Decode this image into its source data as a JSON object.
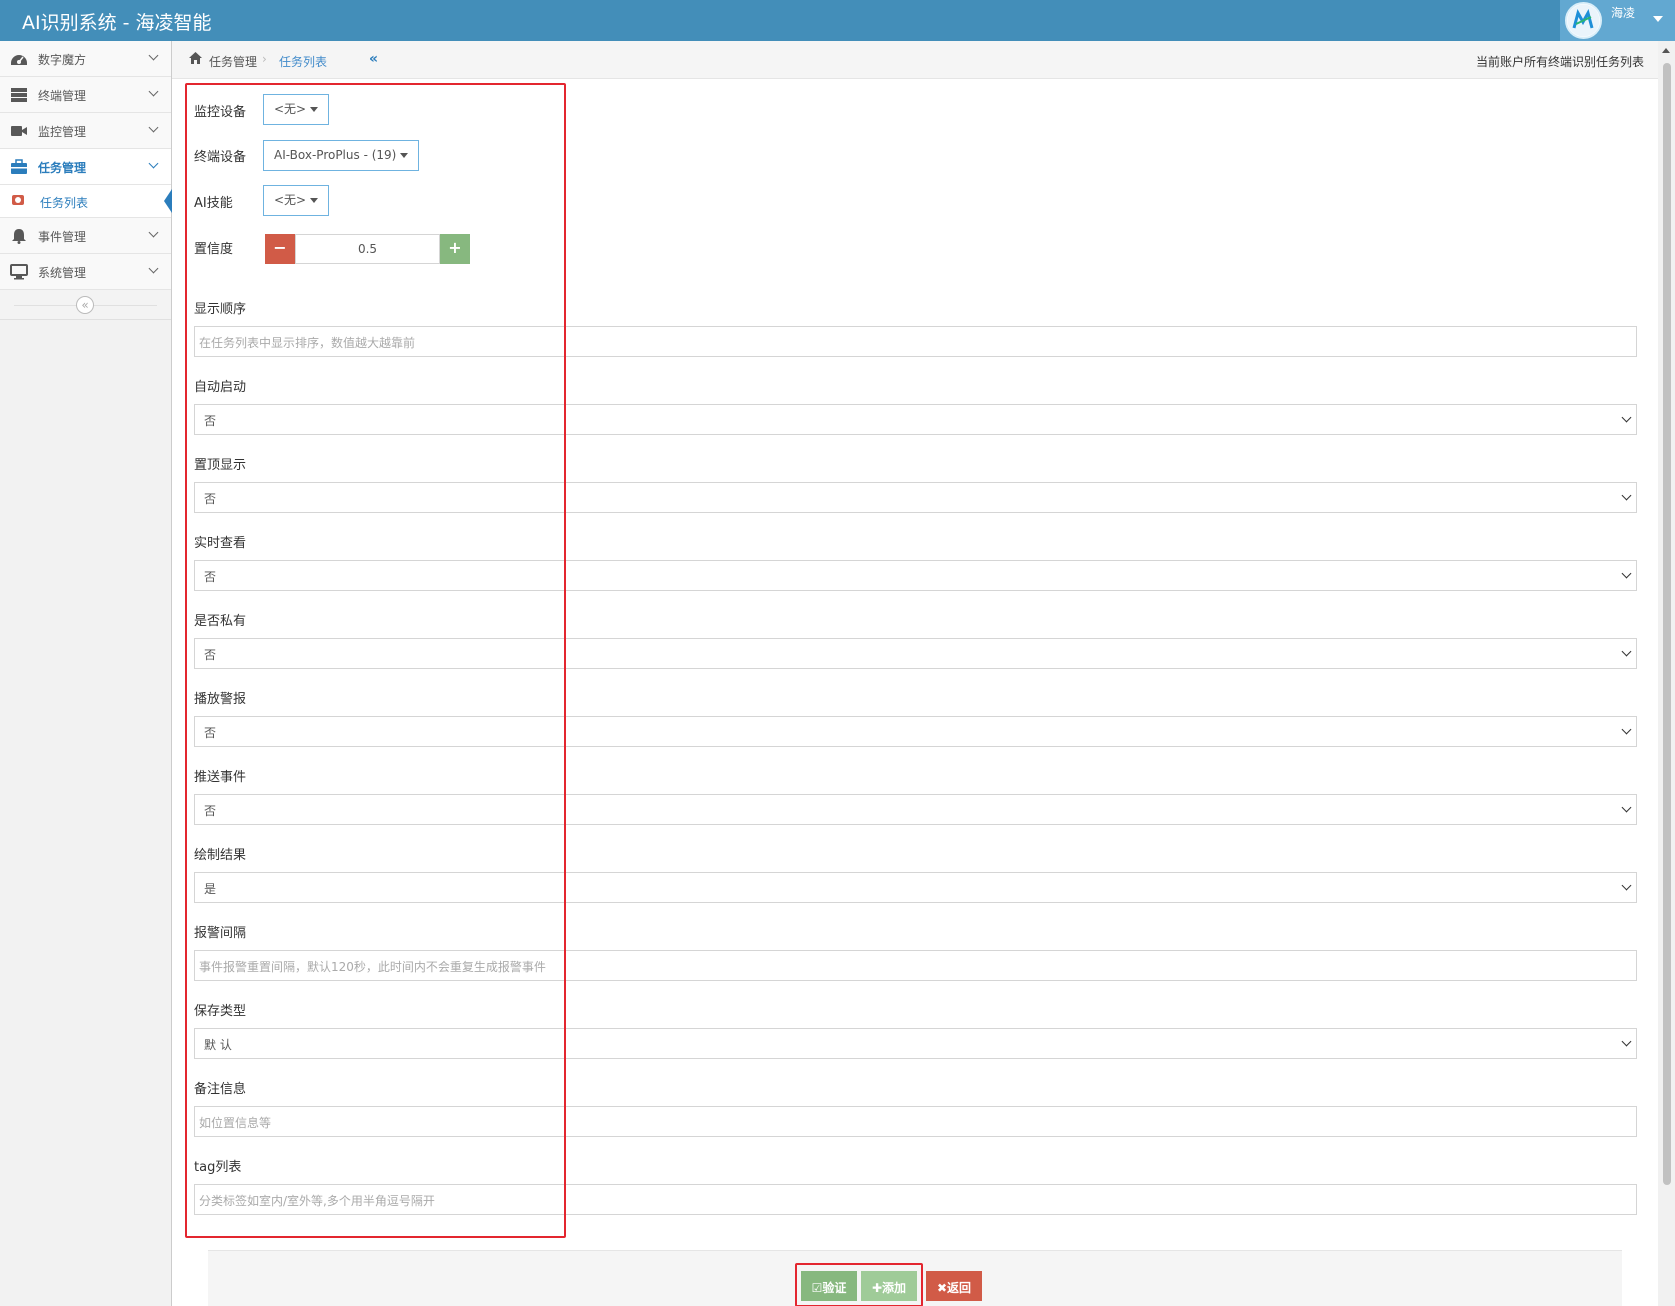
{
  "app": {
    "title": "AI识别系统 - 海凌智能",
    "user_name": "海凌"
  },
  "sidebar": {
    "items": [
      {
        "label": "数字魔方",
        "icon": "dashboard-icon"
      },
      {
        "label": "终端管理",
        "icon": "server-icon"
      },
      {
        "label": "监控管理",
        "icon": "video-camera-icon"
      },
      {
        "label": "任务管理",
        "icon": "briefcase-icon",
        "active": true
      },
      {
        "label": "事件管理",
        "icon": "bell-icon"
      },
      {
        "label": "系统管理",
        "icon": "desktop-icon"
      }
    ],
    "sub_item": {
      "label": "任务列表",
      "icon": "camera-icon"
    },
    "collapse_icon": "double-chevron-left-icon"
  },
  "breadcrumb": {
    "home_icon": "home-icon",
    "level1": "任务管理",
    "separator": "›",
    "level2": "任务列表",
    "right_text": "当前账户所有终端识别任务列表"
  },
  "form": {
    "monitor_device": {
      "label": "监控设备",
      "value": "<无>"
    },
    "terminal_device": {
      "label": "终端设备",
      "value": "AI-Box-ProPlus - (19)"
    },
    "ai_skill": {
      "label": "AI技能",
      "value": "<无>"
    },
    "confidence": {
      "label": "置信度",
      "value": "0.5",
      "minus": "−",
      "plus": "+"
    },
    "display_order": {
      "label": "显示顺序",
      "placeholder": "在任务列表中显示排序，数值越大越靠前"
    },
    "auto_start": {
      "label": "自动启动",
      "value": "否"
    },
    "pin_top": {
      "label": "置顶显示",
      "value": "否"
    },
    "live_view": {
      "label": "实时查看",
      "value": "否"
    },
    "is_private": {
      "label": "是否私有",
      "value": "否"
    },
    "play_alarm": {
      "label": "播放警报",
      "value": "否"
    },
    "push_event": {
      "label": "推送事件",
      "value": "否"
    },
    "draw_result": {
      "label": "绘制结果",
      "value": "是"
    },
    "alarm_interval": {
      "label": "报警间隔",
      "placeholder": "事件报警重置间隔，默认120秒，此时间内不会重复生成报警事件"
    },
    "save_type": {
      "label": "保存类型",
      "value": "默 认"
    },
    "remark": {
      "label": "备注信息",
      "placeholder": "如位置信息等"
    },
    "tags": {
      "label": "tag列表",
      "placeholder": "分类标签如室内/室外等,多个用半角逗号隔开"
    }
  },
  "actions": {
    "verify": "☑验证",
    "add": "✚添加",
    "back": "✖返回"
  },
  "colors": {
    "navbar": "#438eb9",
    "accent": "#2b7dbc",
    "danger": "#d15b47",
    "success": "#87b87f",
    "highlight": "#e3262f"
  }
}
